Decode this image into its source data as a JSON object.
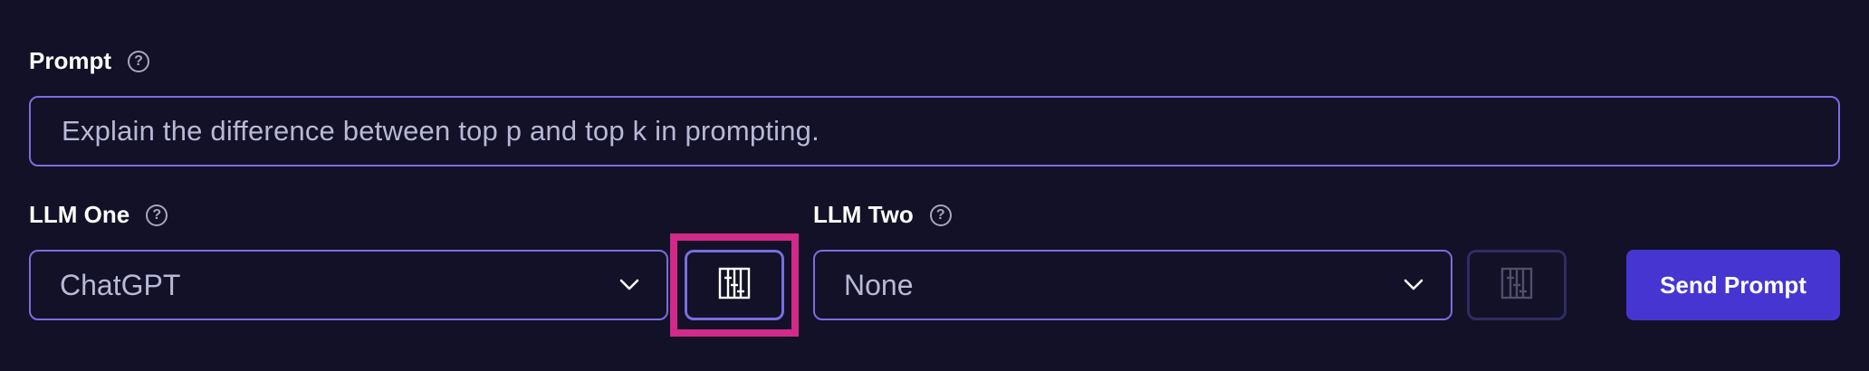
{
  "prompt": {
    "label": "Prompt",
    "help_icon": "help-circle-icon",
    "value": "Explain the difference between top p and top k in prompting."
  },
  "llm_one": {
    "label": "LLM One",
    "help_icon": "help-circle-icon",
    "selected": "ChatGPT",
    "settings_icon": "sliders-icon"
  },
  "llm_two": {
    "label": "LLM Two",
    "help_icon": "help-circle-icon",
    "selected": "None",
    "settings_icon": "sliders-icon"
  },
  "actions": {
    "send_label": "Send Prompt"
  },
  "colors": {
    "background": "#121127",
    "border_accent": "#7a6de1",
    "button_primary": "#4536d2",
    "highlight": "#d12a89",
    "muted_text": "#b8b8d7"
  }
}
